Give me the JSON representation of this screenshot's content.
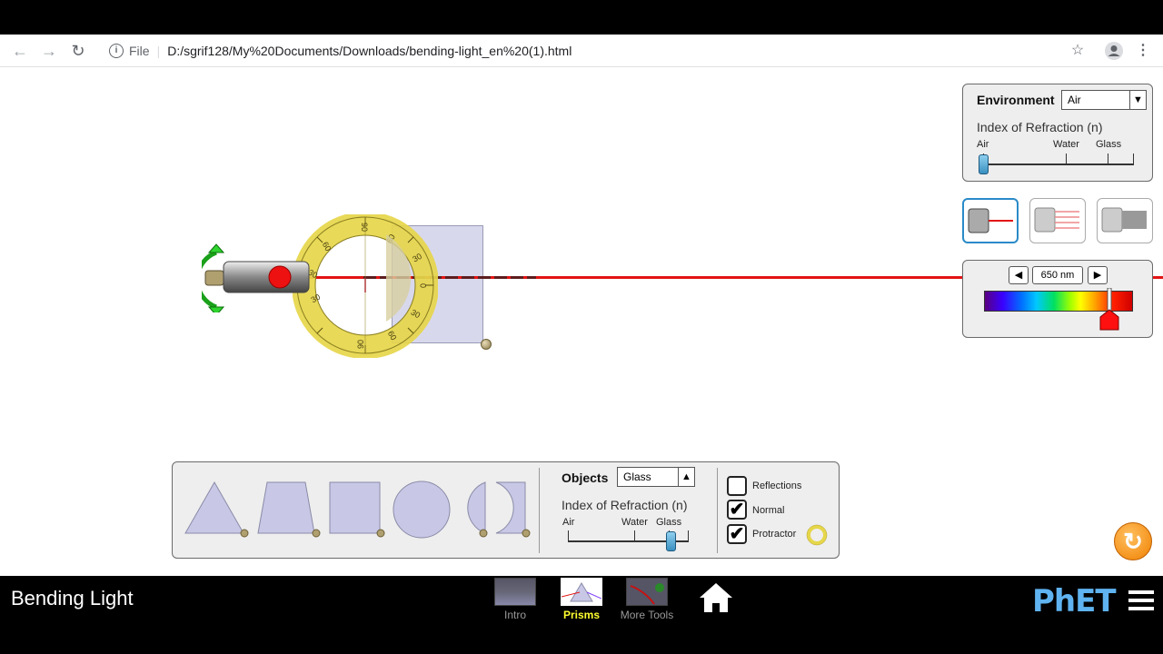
{
  "browser": {
    "url": "D:/sgrif128/My%20Documents/Downloads/bending-light_en%20(1).html",
    "file_label": "File"
  },
  "environment": {
    "label": "Environment",
    "value": "Air",
    "ior_label": "Index of Refraction (n)",
    "ticks": [
      "Air",
      "Water",
      "Glass"
    ],
    "slider_fraction": 0.0
  },
  "wavelength": {
    "value": "650 nm",
    "slider_fraction": 0.84
  },
  "objects": {
    "label": "Objects",
    "value": "Glass",
    "ior_label": "Index of Refraction (n)",
    "ticks": [
      "Air",
      "Water",
      "Glass"
    ],
    "slider_fraction": 0.85
  },
  "options": {
    "reflections": {
      "label": "Reflections",
      "checked": false
    },
    "normal": {
      "label": "Normal",
      "checked": true
    },
    "protractor": {
      "label": "Protractor",
      "checked": true
    }
  },
  "protractor_labels": [
    "90",
    "60",
    "30",
    "0",
    "30",
    "60",
    "90",
    "60",
    "30",
    "30",
    "60",
    "90"
  ],
  "navbar": {
    "title": "Bending Light",
    "tabs": [
      {
        "label": "Intro",
        "active": false
      },
      {
        "label": "Prisms",
        "active": true
      },
      {
        "label": "More Tools",
        "active": false
      }
    ],
    "brand": "PhET"
  },
  "colors": {
    "laser": "#e31414",
    "active_tab": "#ffff30",
    "panel_bg": "#eeeeee",
    "accent_blue": "#2a8ac8"
  }
}
